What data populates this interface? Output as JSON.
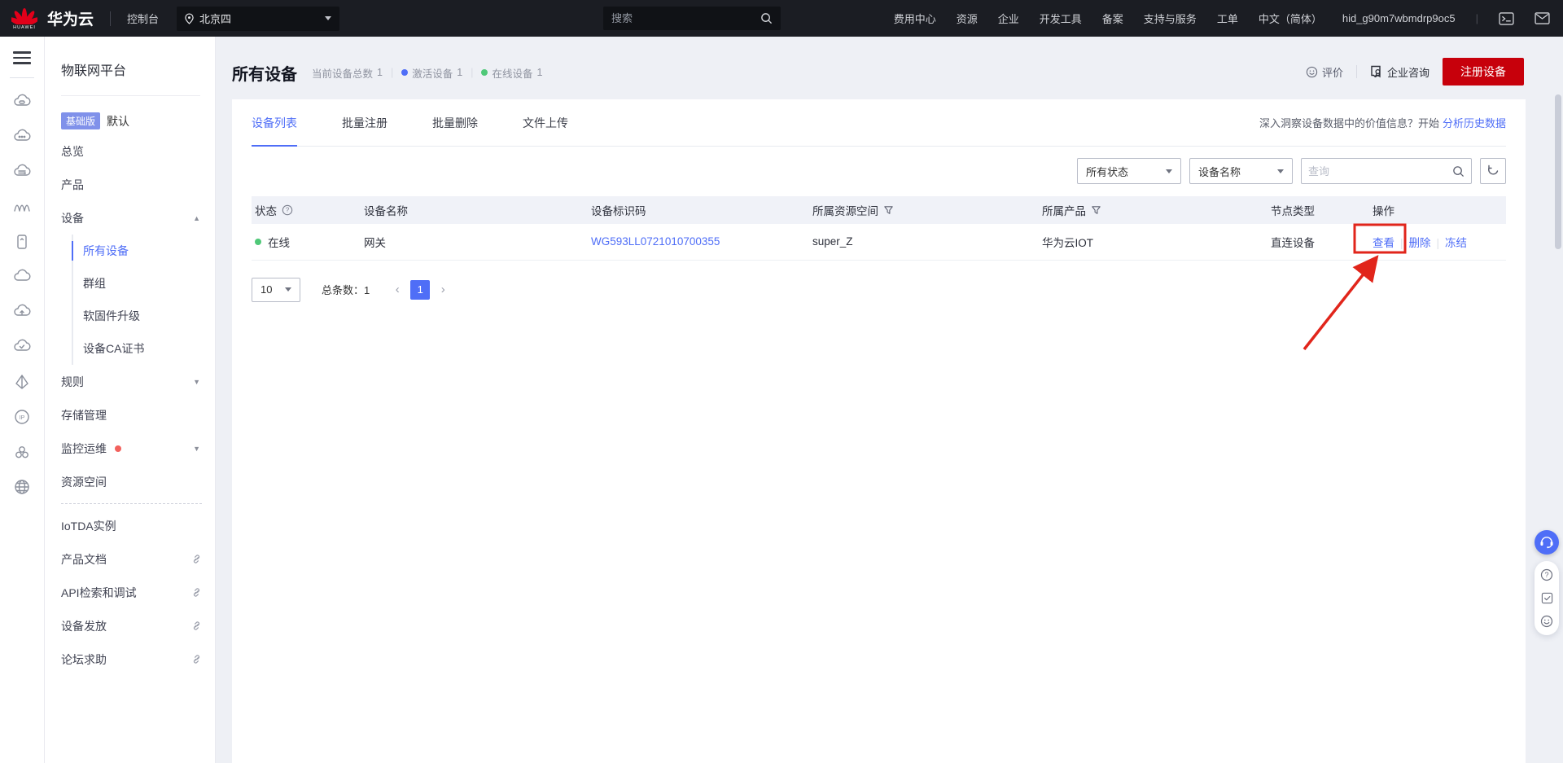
{
  "topbar": {
    "brand": "华为云",
    "console": "控制台",
    "region": "北京四",
    "search_placeholder": "搜索",
    "nav": [
      "费用中心",
      "资源",
      "企业",
      "开发工具",
      "备案",
      "支持与服务",
      "工单",
      "中文（简体）"
    ],
    "account": "hid_g90m7wbmdrp9oc5"
  },
  "sidebar": {
    "title": "物联网平台",
    "badge": "基础版",
    "badge_suffix": "默认",
    "items": [
      {
        "label": "总览"
      },
      {
        "label": "产品"
      },
      {
        "label": "设备",
        "expanded": true
      },
      {
        "label": "所有设备",
        "active": true
      },
      {
        "label": "群组"
      },
      {
        "label": "软固件升级"
      },
      {
        "label": "设备CA证书"
      },
      {
        "label": "规则"
      },
      {
        "label": "存储管理"
      },
      {
        "label": "监控运维",
        "has_red_dot": true
      },
      {
        "label": "资源空间"
      },
      {
        "label": "IoTDA实例"
      },
      {
        "label": "产品文档",
        "external": true
      },
      {
        "label": "API检索和调试",
        "external": true
      },
      {
        "label": "设备发放",
        "external": true
      },
      {
        "label": "论坛求助",
        "external": true
      }
    ]
  },
  "header": {
    "title": "所有设备",
    "stats": [
      {
        "label": "当前设备总数",
        "value": "1"
      },
      {
        "label": "激活设备",
        "value": "1"
      },
      {
        "label": "在线设备",
        "value": "1"
      }
    ],
    "rate_label": "评价",
    "consult_label": "企业咨询",
    "register_label": "注册设备"
  },
  "tabs": [
    {
      "label": "设备列表"
    },
    {
      "label": "批量注册"
    },
    {
      "label": "批量删除"
    },
    {
      "label": "文件上传"
    }
  ],
  "insight": {
    "text": "深入洞察设备数据中的价值信息？开始",
    "link": "分析历史数据"
  },
  "filters": {
    "status": "所有状态",
    "field": "设备名称",
    "search_placeholder": "查询"
  },
  "table": {
    "columns": [
      {
        "label": "状态"
      },
      {
        "label": "设备名称"
      },
      {
        "label": "设备标识码"
      },
      {
        "label": "所属资源空间"
      },
      {
        "label": "所属产品"
      },
      {
        "label": "节点类型"
      },
      {
        "label": "操作"
      }
    ],
    "rows": [
      {
        "status": "在线",
        "name": "网关",
        "code": "WG593LL0721010700355",
        "space": "super_Z",
        "product": "华为云IOT",
        "node_type": "直连设备",
        "actions": [
          "查看",
          "删除",
          "冻结"
        ]
      }
    ]
  },
  "pagination": {
    "page_size": "10",
    "total_label": "总条数：1",
    "page": "1"
  },
  "colors": {
    "accent_blue": "#4f6ef7",
    "huawei_red": "#c7000b",
    "online_green": "#4fc878",
    "annotation_red": "#e1251b",
    "badge_purple": "#8091ea"
  }
}
